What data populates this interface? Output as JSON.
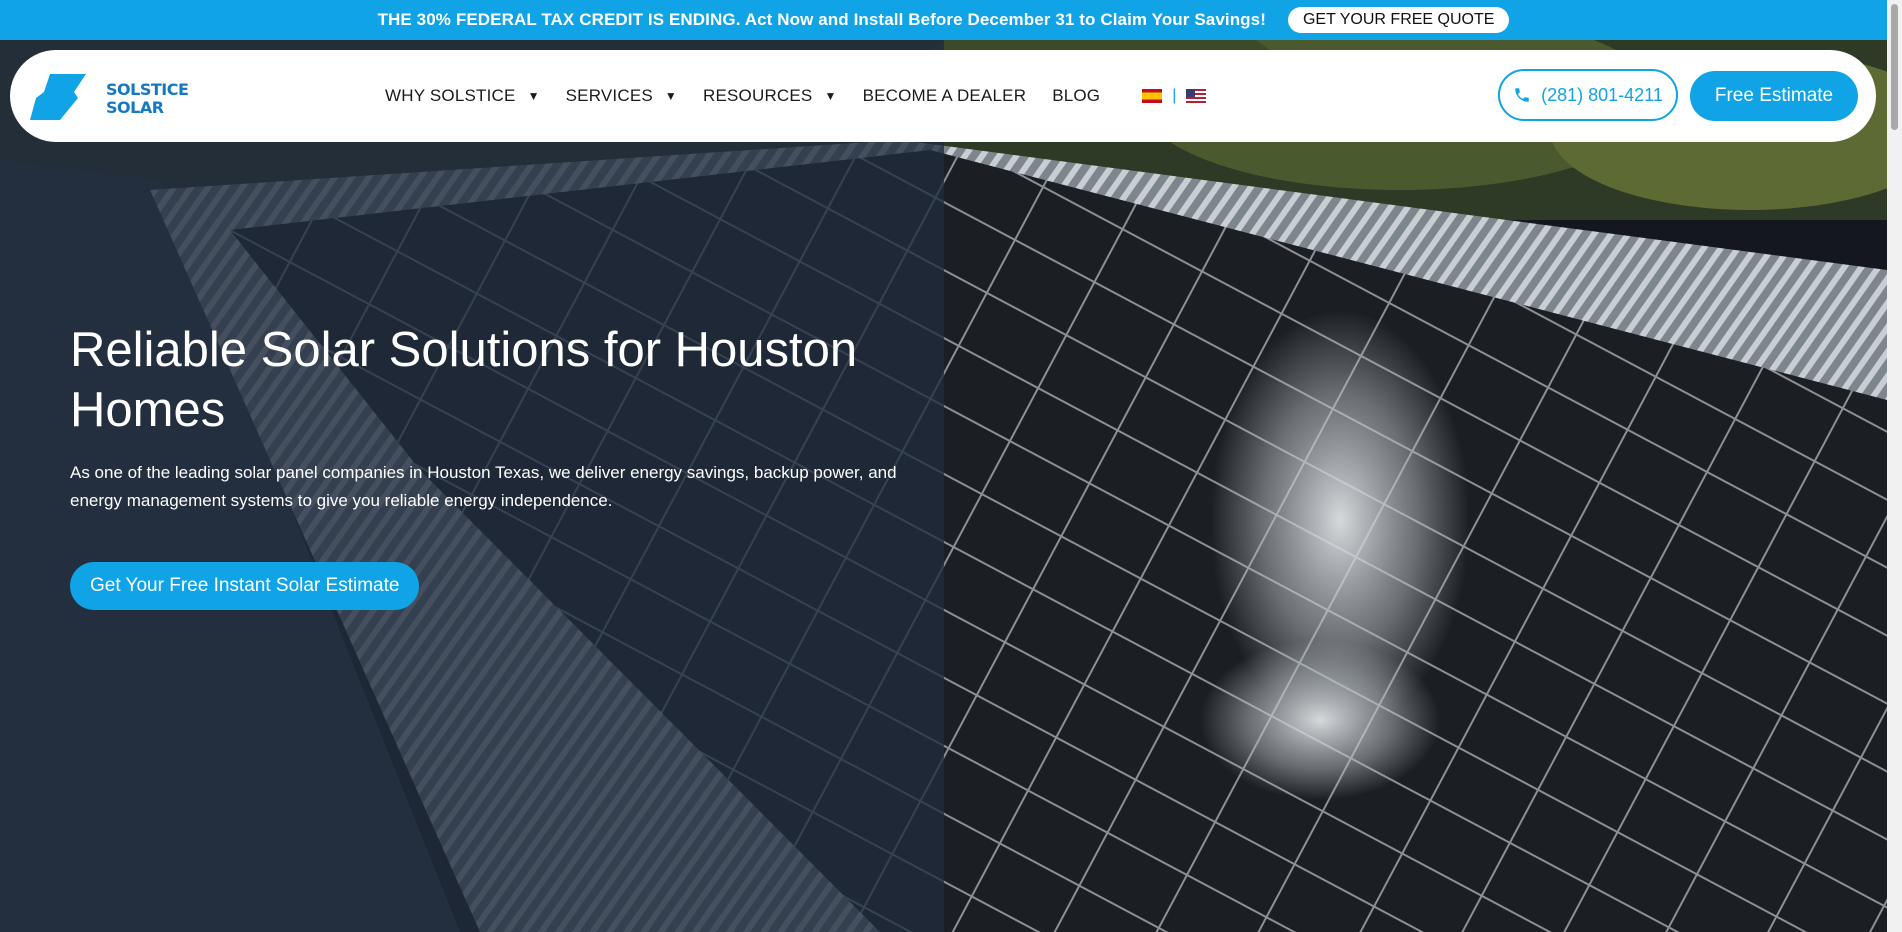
{
  "promo": {
    "text": "THE 30% FEDERAL TAX CREDIT IS ENDING. Act Now and Install Before December 31 to Claim Your Savings!",
    "button_label": "GET YOUR FREE QUOTE"
  },
  "header": {
    "logo": {
      "line1": "SOLSTICE",
      "line2": "SOLAR"
    },
    "nav": [
      {
        "label": "WHY SOLSTICE",
        "has_dropdown": true
      },
      {
        "label": "SERVICES",
        "has_dropdown": true
      },
      {
        "label": "RESOURCES",
        "has_dropdown": true
      },
      {
        "label": "BECOME A DEALER",
        "has_dropdown": false
      },
      {
        "label": "BLOG",
        "has_dropdown": false
      }
    ],
    "languages": {
      "separator": "|",
      "flags": [
        "spanish-flag-icon",
        "us-flag-icon"
      ]
    },
    "phone": "(281) 801-4211",
    "cta_label": "Free Estimate"
  },
  "hero": {
    "title": "Reliable Solar Solutions for Houston Homes",
    "description": "As one of the leading solar panel companies in Houston Texas, we deliver energy savings, backup power, and energy management systems to give you reliable energy independence.",
    "cta_label": "Get Your Free Instant Solar Estimate"
  },
  "colors": {
    "accent": "#10a3e6",
    "logo_blue": "#1479c2",
    "overlay": "#202c3e"
  }
}
